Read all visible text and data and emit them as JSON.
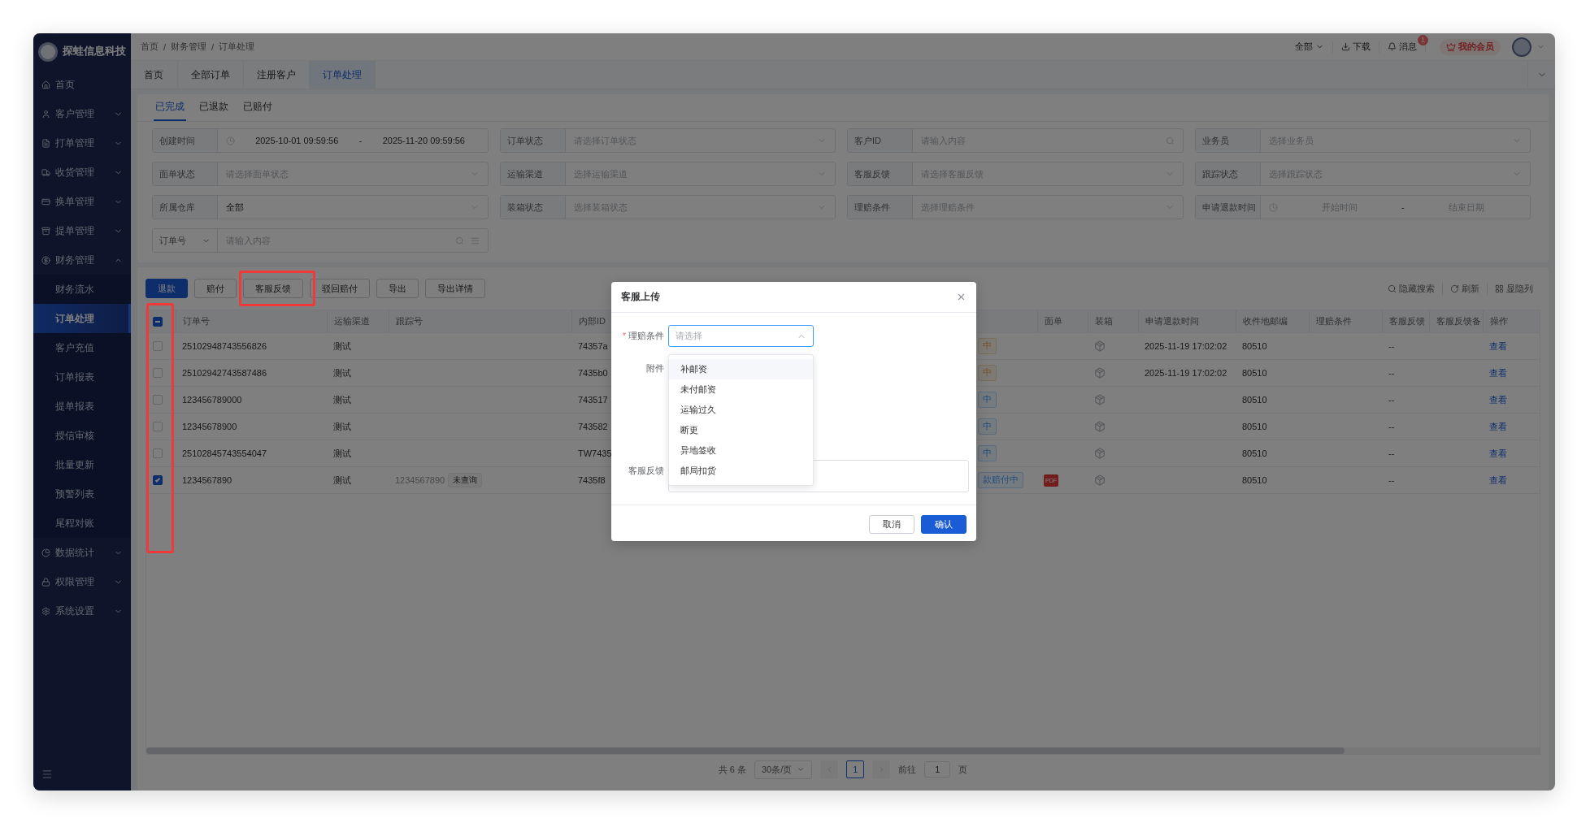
{
  "brand": {
    "name": "探蛙信息科技"
  },
  "sidebar": {
    "items": [
      {
        "label": "首页",
        "kind": "link",
        "selected": false
      },
      {
        "label": "客户管理",
        "kind": "group",
        "expanded": false,
        "selected": false
      },
      {
        "label": "打单管理",
        "kind": "group",
        "expanded": false,
        "selected": false
      },
      {
        "label": "收货管理",
        "kind": "group",
        "expanded": false,
        "selected": false
      },
      {
        "label": "换单管理",
        "kind": "group",
        "expanded": false,
        "selected": false
      },
      {
        "label": "提单管理",
        "kind": "group",
        "expanded": false,
        "selected": false
      },
      {
        "label": "财务管理",
        "kind": "group",
        "expanded": true,
        "selected": false,
        "children": [
          {
            "label": "财务流水",
            "selected": false
          },
          {
            "label": "订单处理",
            "selected": true
          },
          {
            "label": "客户充值",
            "selected": false
          },
          {
            "label": "订单报表",
            "selected": false
          },
          {
            "label": "提单报表",
            "selected": false
          },
          {
            "label": "授信审核",
            "selected": false
          },
          {
            "label": "批量更新",
            "selected": false
          },
          {
            "label": "预警列表",
            "selected": false
          },
          {
            "label": "尾程对账",
            "selected": false
          }
        ]
      },
      {
        "label": "数据统计",
        "kind": "group",
        "expanded": false,
        "selected": false
      },
      {
        "label": "权限管理",
        "kind": "group",
        "expanded": false,
        "selected": false
      },
      {
        "label": "系统设置",
        "kind": "group",
        "expanded": false,
        "selected": false
      }
    ]
  },
  "breadcrumbs": [
    "首页",
    "财务管理",
    "订单处理"
  ],
  "breadcrumb_separator": "/",
  "header": {
    "scope": "全部",
    "download": "下载",
    "messages": "消息",
    "message_badge": "1",
    "member": "我的会员"
  },
  "page_tabs": [
    {
      "label": "首页",
      "selected": false
    },
    {
      "label": "全部订单",
      "selected": false
    },
    {
      "label": "注册客户",
      "selected": false
    },
    {
      "label": "订单处理",
      "selected": true
    }
  ],
  "sub_tabs": [
    {
      "label": "已完成",
      "selected": true
    },
    {
      "label": "已退款",
      "selected": false
    },
    {
      "label": "已赔付",
      "selected": false
    }
  ],
  "filters": [
    {
      "kind": "date-range",
      "label": "创建时间",
      "start": "2025-10-01 09:59:56",
      "separator": "-",
      "end": "2025-11-20 09:59:56"
    },
    {
      "kind": "select",
      "label": "订单状态",
      "placeholder": "请选择订单状态"
    },
    {
      "kind": "search",
      "label": "客户ID",
      "placeholder": "请输入内容"
    },
    {
      "kind": "select",
      "label": "业务员",
      "placeholder": "选择业务员"
    },
    {
      "kind": "select",
      "label": "面单状态",
      "placeholder": "请选择面单状态"
    },
    {
      "kind": "select",
      "label": "运输渠道",
      "placeholder": "选择运输渠道"
    },
    {
      "kind": "select",
      "label": "客服反馈",
      "placeholder": "请选择客服反馈"
    },
    {
      "kind": "select",
      "label": "跟踪状态",
      "placeholder": "选择跟踪状态"
    },
    {
      "kind": "select",
      "label": "所属仓库",
      "value": "全部"
    },
    {
      "kind": "select",
      "label": "装箱状态",
      "placeholder": "选择装箱状态"
    },
    {
      "kind": "select",
      "label": "理赔条件",
      "placeholder": "选择理赔条件"
    },
    {
      "kind": "date-range",
      "label": "申请退款时间",
      "start_placeholder": "开始时间",
      "separator": "-",
      "end_placeholder": "结束日期"
    },
    {
      "kind": "keyword",
      "label": "订单号",
      "placeholder": "请输入内容"
    }
  ],
  "actions": [
    {
      "label": "退款",
      "kind": "primary"
    },
    {
      "label": "赔付",
      "kind": "default"
    },
    {
      "label": "客服反馈",
      "kind": "default"
    },
    {
      "label": "驳回赔付",
      "kind": "default"
    },
    {
      "label": "导出",
      "kind": "default"
    },
    {
      "label": "导出详情",
      "kind": "default"
    }
  ],
  "table_tools": [
    "隐藏搜索",
    "刷新",
    "显隐列"
  ],
  "table": {
    "select_all": {
      "checked": true,
      "partial": true
    },
    "columns": [
      {
        "kind": "order_no",
        "label": "订单号"
      },
      {
        "kind": "channel",
        "label": "运输渠道"
      },
      {
        "kind": "tracking",
        "label": "跟踪号"
      },
      {
        "kind": "internal_id",
        "label": "内部ID"
      },
      {
        "kind": "waybill",
        "label": "面单"
      },
      {
        "kind": "packing",
        "label": "装箱"
      },
      {
        "kind": "refund_time",
        "label": "申请退款时间"
      },
      {
        "kind": "zip",
        "label": "收件地邮编"
      },
      {
        "kind": "claim",
        "label": "理赔条件"
      },
      {
        "kind": "feedback",
        "label": "客服反馈"
      },
      {
        "kind": "feedback_note",
        "label": "客服反馈备"
      },
      {
        "kind": "action",
        "label": "操作"
      }
    ],
    "rows": [
      {
        "checked": false,
        "order_no": "25102948743556826",
        "channel": "测试",
        "internal_id": "74357a",
        "status": {
          "label": "中",
          "kind": "warning"
        },
        "refund_time": "2025-11-19 17:02:02",
        "zip": "80510",
        "feedback": "--",
        "action": "查看"
      },
      {
        "checked": false,
        "order_no": "25102942743587486",
        "channel": "测试",
        "internal_id": "7435b0",
        "status": {
          "label": "中",
          "kind": "warning"
        },
        "refund_time": "2025-11-19 17:02:02",
        "zip": "80510",
        "feedback": "--",
        "action": "查看"
      },
      {
        "checked": false,
        "order_no": "123456789000",
        "channel": "测试",
        "internal_id": "743517",
        "status": {
          "label": "中",
          "kind": "info"
        },
        "zip": "80510",
        "feedback": "--",
        "action": "查看"
      },
      {
        "checked": false,
        "order_no": "12345678900",
        "channel": "测试",
        "internal_id": "743582",
        "status": {
          "label": "中",
          "kind": "info"
        },
        "zip": "80510",
        "feedback": "--",
        "action": "查看"
      },
      {
        "checked": false,
        "order_no": "25102845743554047",
        "channel": "测试",
        "internal_id": "TW7435",
        "status": {
          "label": "中",
          "kind": "info"
        },
        "zip": "80510",
        "feedback": "--",
        "action": "查看"
      },
      {
        "checked": true,
        "order_no": "1234567890",
        "channel": "测试",
        "tracking": "1234567890",
        "tracking_tag": "未查询",
        "internal_id": "7435f8",
        "status": {
          "label": "款赔付中",
          "kind": "info"
        },
        "waybill": "PDF",
        "zip": "80510",
        "feedback": "--",
        "action": "查看"
      }
    ]
  },
  "pagination": {
    "total": "共 6 条",
    "page_size": "30条/页",
    "pages": [
      {
        "label": "1",
        "selected": true
      }
    ],
    "goto_label": "前往",
    "goto_value": "1",
    "goto_unit": "页"
  },
  "dialog": {
    "title": "客服上传",
    "fields": [
      {
        "kind": "select",
        "label": "理赔条件",
        "required_mark": "*",
        "placeholder": "请选择",
        "open": true,
        "options": [
          {
            "label": "补邮资",
            "highlighted": true
          },
          {
            "label": "未付邮资",
            "highlighted": false
          },
          {
            "label": "运输过久",
            "highlighted": false
          },
          {
            "label": "断更",
            "highlighted": false
          },
          {
            "label": "异地签收",
            "highlighted": false
          },
          {
            "label": "邮局扣货",
            "highlighted": false
          }
        ]
      },
      {
        "kind": "upload",
        "label": "附件"
      },
      {
        "kind": "textarea",
        "label": "客服反馈"
      }
    ],
    "buttons": [
      {
        "label": "取消",
        "kind": "default"
      },
      {
        "label": "确认",
        "kind": "primary"
      }
    ]
  }
}
